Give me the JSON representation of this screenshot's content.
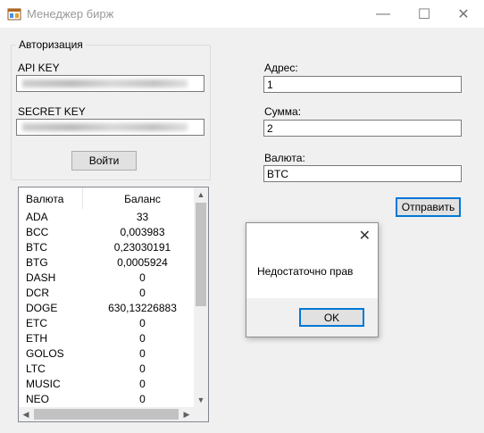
{
  "window": {
    "title": "Менеджер бирж",
    "minimize_glyph": "—",
    "maximize_glyph": "☐",
    "close_glyph": "✕"
  },
  "auth": {
    "group_title": "Авторизация",
    "api_key_label": "API KEY",
    "api_key_value": "",
    "secret_key_label": "SECRET KEY",
    "secret_key_value": "",
    "login_button": "Войти"
  },
  "balances": {
    "col_currency": "Валюта",
    "col_balance": "Баланс",
    "rows": [
      {
        "currency": "ADA",
        "balance": "33"
      },
      {
        "currency": "BCC",
        "balance": "0,003983"
      },
      {
        "currency": "BTC",
        "balance": "0,23030191"
      },
      {
        "currency": "BTG",
        "balance": "0,0005924"
      },
      {
        "currency": "DASH",
        "balance": "0"
      },
      {
        "currency": "DCR",
        "balance": "0"
      },
      {
        "currency": "DOGE",
        "balance": "630,13226883"
      },
      {
        "currency": "ETC",
        "balance": "0"
      },
      {
        "currency": "ETH",
        "balance": "0"
      },
      {
        "currency": "GOLOS",
        "balance": "0"
      },
      {
        "currency": "LTC",
        "balance": "0"
      },
      {
        "currency": "MUSIC",
        "balance": "0"
      },
      {
        "currency": "NEO",
        "balance": "0"
      }
    ]
  },
  "transfer": {
    "address_label": "Адрес:",
    "address_value": "1",
    "amount_label": "Сумма:",
    "amount_value": "2",
    "currency_label": "Валюта:",
    "currency_value": "BTC",
    "send_button": "Отправить"
  },
  "dialog": {
    "message": "Недостаточно прав",
    "ok_button": "OK",
    "close_glyph": "✕"
  },
  "icons": {
    "app": "app-window-icon",
    "scroll_up": "▲",
    "scroll_down": "▼",
    "scroll_left": "◀",
    "scroll_right": "▶"
  },
  "colors": {
    "accent": "#0078d7",
    "window_bg": "#f0f0f0"
  }
}
